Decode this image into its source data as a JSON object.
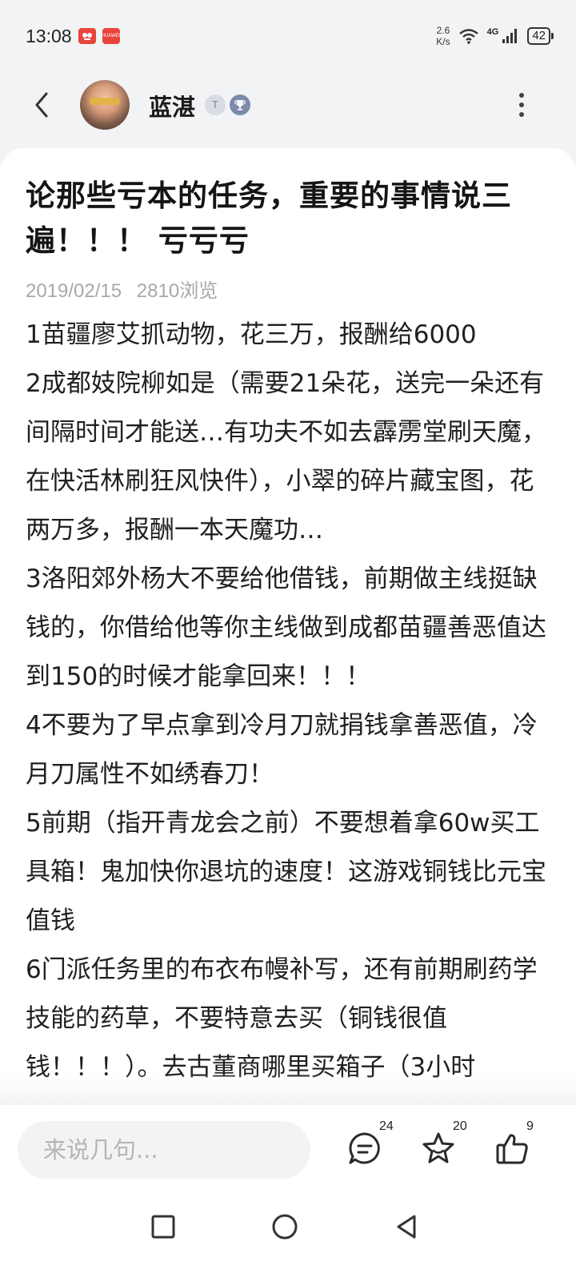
{
  "status_bar": {
    "time": "13:08",
    "notif_badge": "HUAWEI",
    "net_speed_value": "2.6",
    "net_speed_unit": "K/s",
    "network": "4G",
    "battery": "42"
  },
  "header": {
    "user_name": "蓝湛",
    "badge_t": "T",
    "icons": [
      "back-arrow-icon",
      "level-badge-icon",
      "trophy-badge-icon",
      "more-vertical-icon"
    ]
  },
  "post": {
    "title": "论那些亏本的任务，重要的事情说三遍！！！ 亏亏亏",
    "date": "2019/02/15",
    "views": "2810浏览",
    "paragraphs": [
      "1苗疆廖艾抓动物，花三万，报酬给6000",
      "2成都妓院柳如是（需要21朵花，送完一朵还有间隔时间才能送…有功夫不如去霹雳堂刷天魔，在快活林刷狂风快件），小翠的碎片藏宝图，花两万多，报酬一本天魔功…",
      "3洛阳郊外杨大不要给他借钱，前期做主线挺缺钱的，你借给他等你主线做到成都苗疆善恶值达到150的时候才能拿回来！！！",
      "4不要为了早点拿到冷月刀就捐钱拿善恶值，冷月刀属性不如绣春刀！",
      "5前期（指开青龙会之前）不要想着拿60w买工具箱！鬼加快你退坑的速度！这游戏铜钱比元宝值钱",
      "6门派任务里的布衣布幔补写，还有前期刷药学技能的药草，不要特意去买（铜钱很值钱！！！）。去古董商哪里买箱子（3小时"
    ]
  },
  "action_bar": {
    "comment_placeholder": "来说几句...",
    "comments_count": "24",
    "favorites_count": "20",
    "likes_count": "9"
  },
  "colors": {
    "background": "#f2f3f5",
    "card": "#ffffff",
    "text": "#202020",
    "meta": "#a8a8a8"
  }
}
